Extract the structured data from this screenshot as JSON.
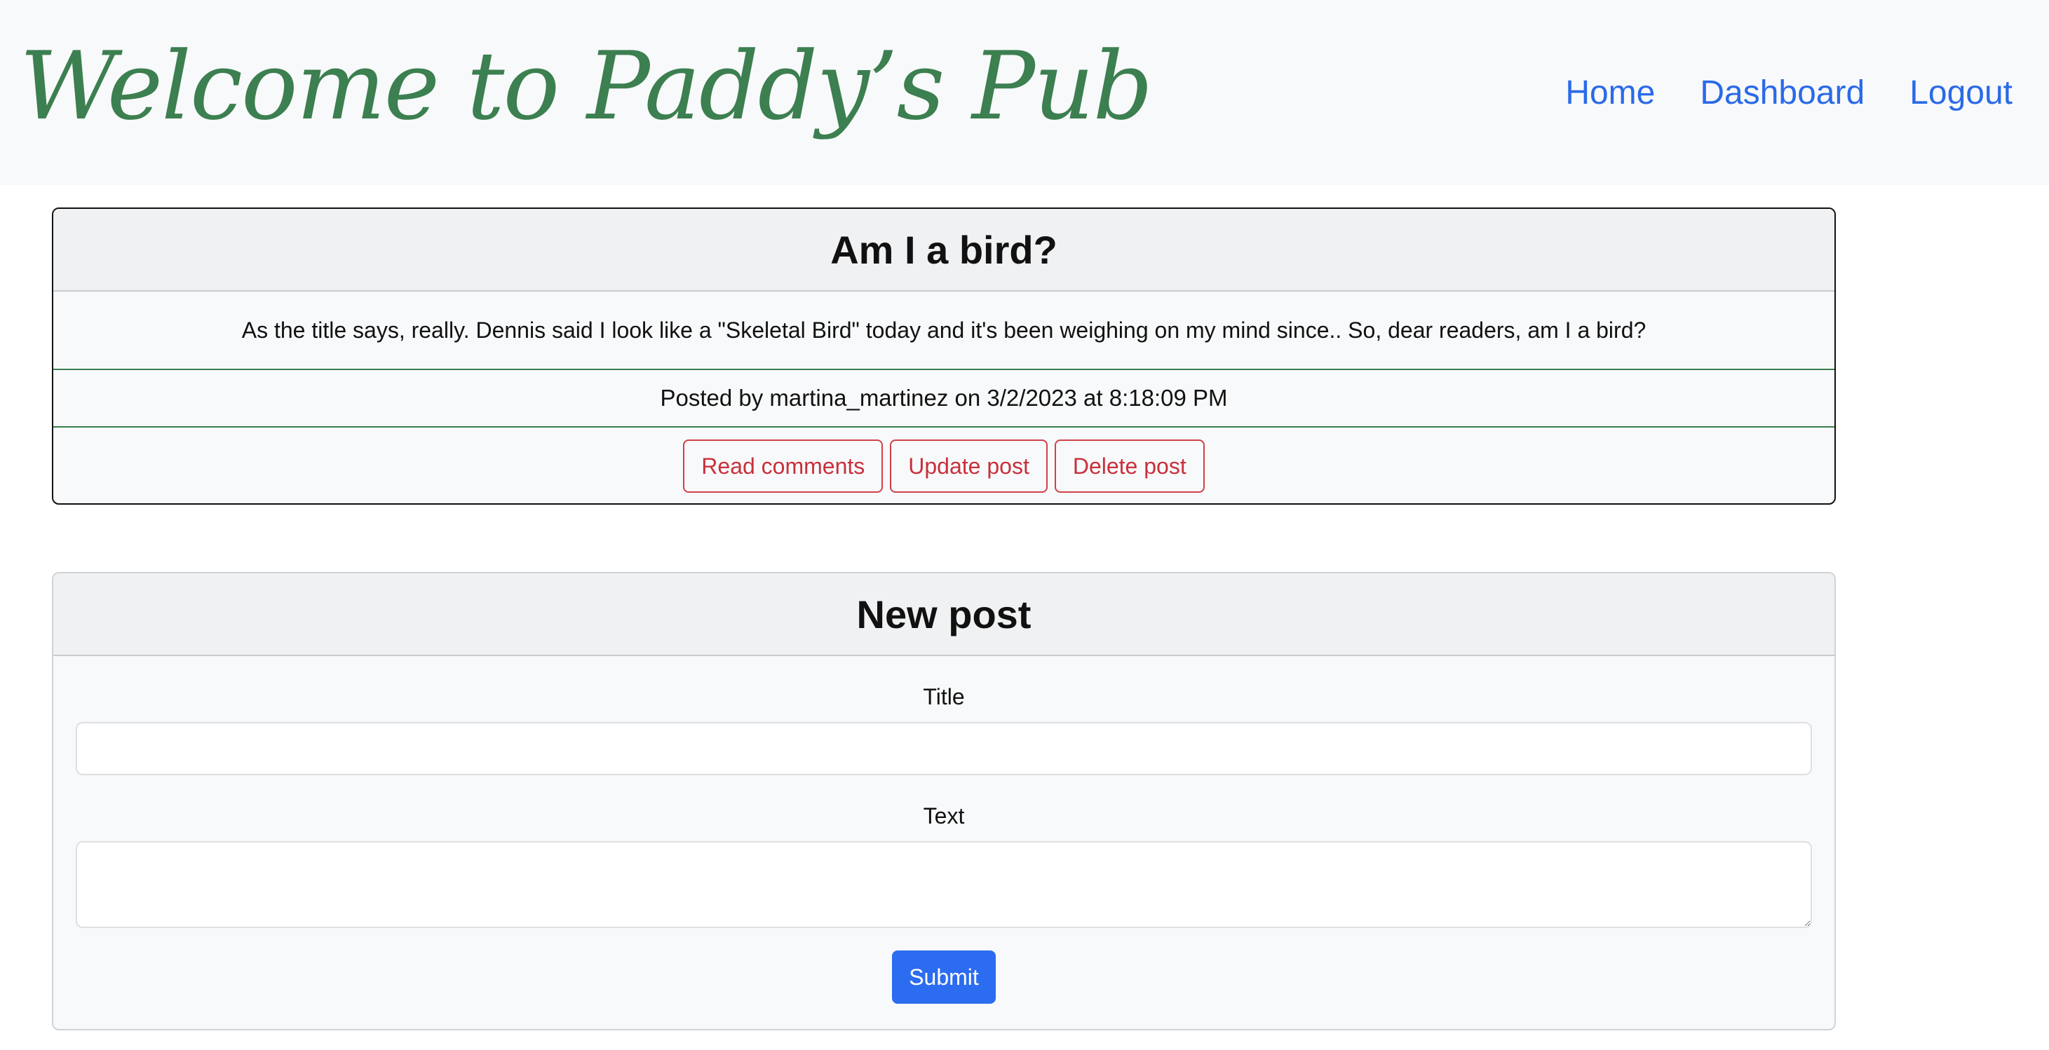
{
  "header": {
    "brand": "Welcome to Paddy’s Pub",
    "nav": {
      "home": "Home",
      "dashboard": "Dashboard",
      "logout": "Logout"
    }
  },
  "post": {
    "title": "Am I a bird?",
    "body": "As the title says, really. Dennis said I look like a \"Skeletal Bird\" today and it's been weighing on my mind since.. So, dear readers, am I a bird?",
    "meta": "Posted by martina_martinez on 3/2/2023 at 8:18:09 PM",
    "actions": {
      "read_comments": "Read comments",
      "update": "Update post",
      "delete": "Delete post"
    }
  },
  "new_post": {
    "heading": "New post",
    "title_label": "Title",
    "title_value": "",
    "text_label": "Text",
    "text_value": "",
    "submit": "Submit"
  },
  "colors": {
    "brand": "#3c7f50",
    "nav_link": "#2a6ae8",
    "danger": "#c8303c",
    "primary": "#2b6cf0"
  }
}
